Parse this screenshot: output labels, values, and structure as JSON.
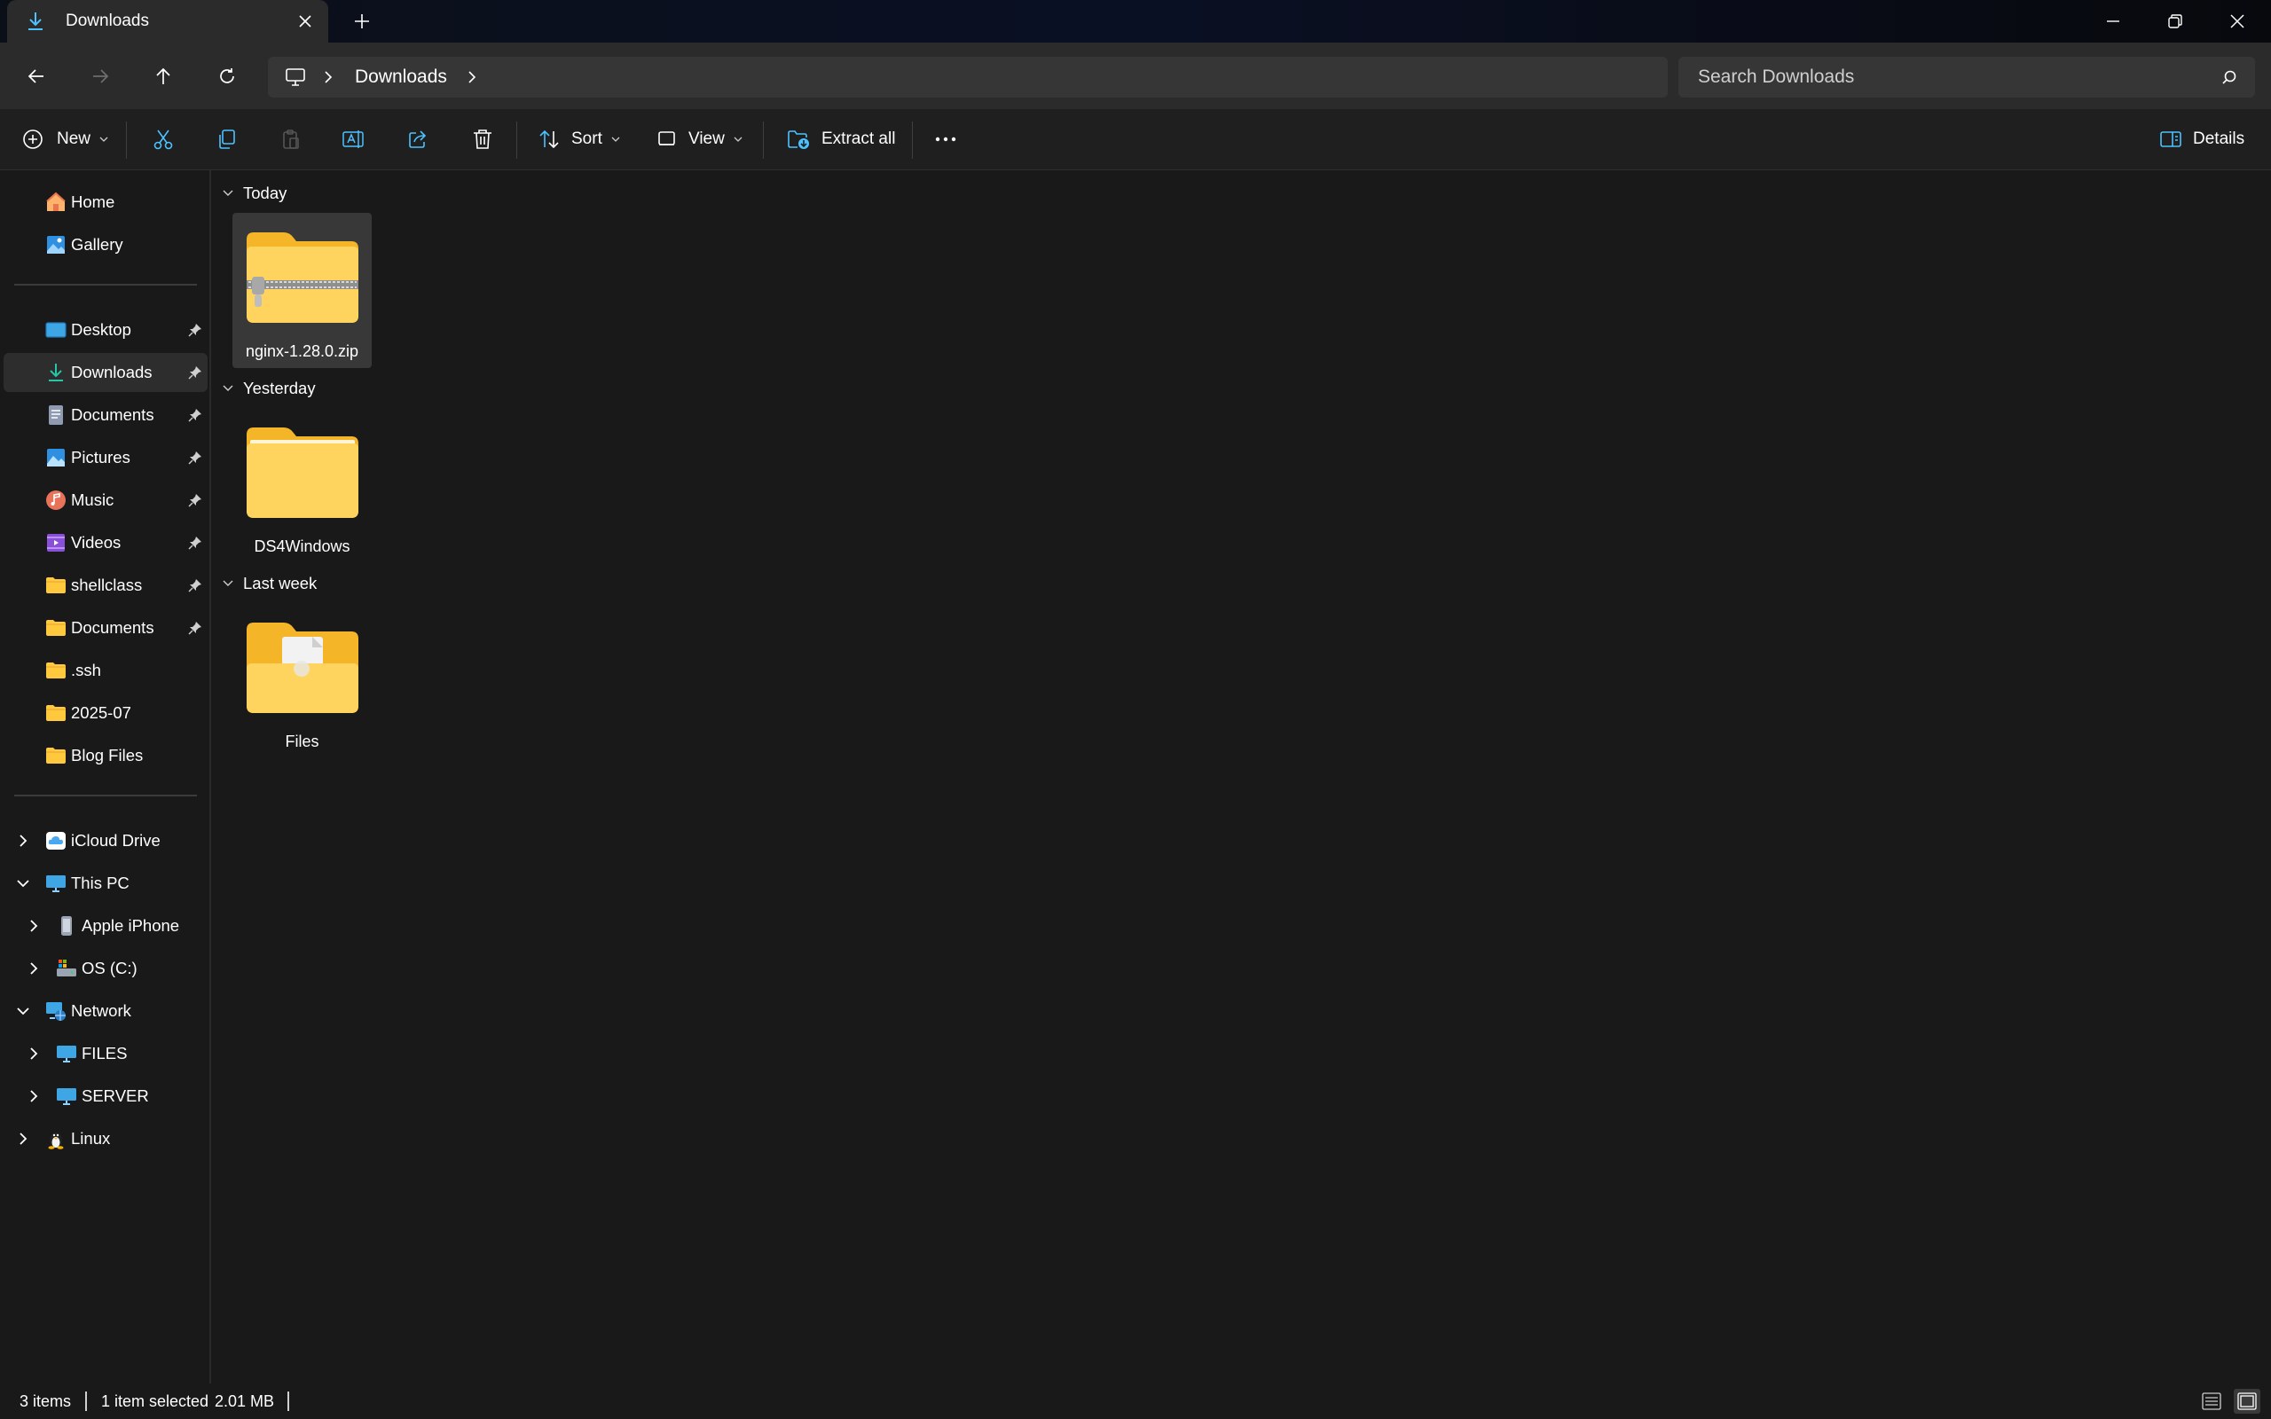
{
  "window": {
    "tab_title": "Downloads",
    "tab_icon": "download-icon",
    "new_tab_icon": "plus-icon",
    "controls": [
      "minimize-icon",
      "restore-icon",
      "close-icon"
    ]
  },
  "nav": {
    "back_icon": "arrow-left-icon",
    "forward_icon": "arrow-right-icon",
    "up_icon": "arrow-up-icon",
    "refresh_icon": "refresh-icon",
    "breadcrumb": [
      "Downloads"
    ]
  },
  "search": {
    "placeholder": "Search Downloads",
    "value": ""
  },
  "commands": {
    "new_label": "New",
    "sort_label": "Sort",
    "view_label": "View",
    "extract_label": "Extract all",
    "details_label": "Details",
    "icons": [
      "cut-icon",
      "copy-icon",
      "paste-icon",
      "rename-icon",
      "share-icon",
      "delete-icon",
      "more-icon"
    ]
  },
  "sidebar": {
    "top": [
      {
        "label": "Home",
        "icon": "home-icon"
      },
      {
        "label": "Gallery",
        "icon": "gallery-icon"
      }
    ],
    "pinned": [
      {
        "label": "Desktop",
        "icon": "desktop-icon"
      },
      {
        "label": "Downloads",
        "icon": "download-icon",
        "selected": true
      },
      {
        "label": "Documents",
        "icon": "documents-icon"
      },
      {
        "label": "Pictures",
        "icon": "pictures-icon"
      },
      {
        "label": "Music",
        "icon": "music-icon"
      },
      {
        "label": "Videos",
        "icon": "videos-icon"
      },
      {
        "label": "shellclass",
        "icon": "folder-icon"
      },
      {
        "label": "Documents",
        "icon": "folder-icon"
      }
    ],
    "recent": [
      {
        "label": ".ssh",
        "icon": "folder-icon"
      },
      {
        "label": "2025-07",
        "icon": "folder-icon"
      },
      {
        "label": "Blog Files",
        "icon": "folder-icon"
      }
    ],
    "tree": [
      {
        "label": "iCloud Drive",
        "icon": "icloud-icon",
        "expanded": false
      },
      {
        "label": "This PC",
        "icon": "pc-icon",
        "expanded": true
      },
      {
        "label": "Apple iPhone",
        "icon": "phone-icon",
        "expanded": false
      },
      {
        "label": "OS (C:)",
        "icon": "drive-icon",
        "expanded": false
      },
      {
        "label": "Network",
        "icon": "network-icon",
        "expanded": true
      },
      {
        "label": "FILES",
        "icon": "computer-icon",
        "expanded": false
      },
      {
        "label": "SERVER",
        "icon": "computer-icon",
        "expanded": false
      },
      {
        "label": "Linux",
        "icon": "linux-icon",
        "expanded": false
      }
    ]
  },
  "groups": [
    {
      "header": "Today",
      "items": [
        {
          "name": "nginx-1.28.0.zip",
          "type": "zip",
          "selected": true
        }
      ]
    },
    {
      "header": "Yesterday",
      "items": [
        {
          "name": "DS4Windows",
          "type": "folder",
          "selected": false
        }
      ]
    },
    {
      "header": "Last week",
      "items": [
        {
          "name": "Files",
          "type": "folder-with-file",
          "selected": false
        }
      ]
    }
  ],
  "status": {
    "count": "3 items",
    "selection": "1 item selected",
    "size": "2.01 MB"
  },
  "colors": {
    "accent": "#4cc2ff",
    "folder": "#ffc83d",
    "background": "#191919"
  }
}
